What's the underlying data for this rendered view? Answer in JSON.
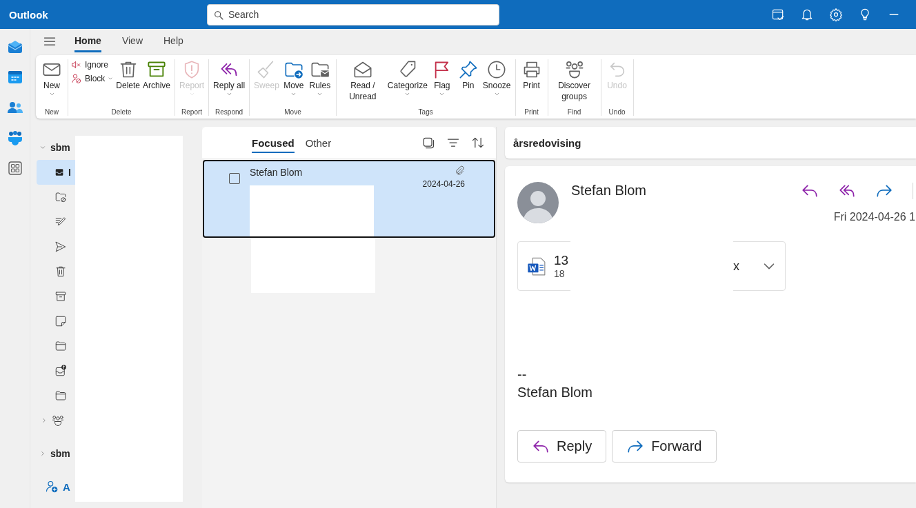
{
  "app": {
    "title": "Outlook"
  },
  "search": {
    "placeholder": "Search"
  },
  "tabs": [
    {
      "label": "Home",
      "selected": true
    },
    {
      "label": "View",
      "selected": false
    },
    {
      "label": "Help",
      "selected": false
    }
  ],
  "ribbon": {
    "groups": [
      {
        "label": "New",
        "buttons": [
          {
            "kind": "large",
            "label": "New",
            "caret": true,
            "disabled": false
          }
        ]
      },
      {
        "label": "Delete",
        "buttons": [
          {
            "kind": "small",
            "label": "Ignore",
            "caret": false,
            "disabled": false
          },
          {
            "kind": "small",
            "label": "Block",
            "caret": true,
            "disabled": false
          },
          {
            "kind": "large",
            "label": "Delete",
            "caret": false,
            "disabled": false
          },
          {
            "kind": "large",
            "label": "Archive",
            "caret": false,
            "disabled": false
          }
        ]
      },
      {
        "label": "Report",
        "buttons": [
          {
            "kind": "large",
            "label": "Report",
            "caret": true,
            "disabled": true
          }
        ]
      },
      {
        "label": "Respond",
        "buttons": [
          {
            "kind": "large",
            "label": "Reply all",
            "caret": true,
            "disabled": false
          }
        ]
      },
      {
        "label": "Move",
        "buttons": [
          {
            "kind": "large",
            "label": "Sweep",
            "caret": false,
            "disabled": true
          },
          {
            "kind": "large",
            "label": "Move",
            "caret": true,
            "disabled": false
          },
          {
            "kind": "large",
            "label": "Rules",
            "caret": true,
            "disabled": false
          }
        ]
      },
      {
        "label": "Tags",
        "buttons": [
          {
            "kind": "large",
            "label": "Read / Unread",
            "caret": false,
            "disabled": false
          },
          {
            "kind": "large",
            "label": "Categorize",
            "caret": true,
            "disabled": false
          },
          {
            "kind": "large",
            "label": "Flag",
            "caret": true,
            "disabled": false
          },
          {
            "kind": "large",
            "label": "Pin",
            "caret": false,
            "disabled": false
          },
          {
            "kind": "large",
            "label": "Snooze",
            "caret": true,
            "disabled": false
          }
        ]
      },
      {
        "label": "Print",
        "buttons": [
          {
            "kind": "large",
            "label": "Print",
            "caret": false,
            "disabled": false
          }
        ]
      },
      {
        "label": "Find",
        "buttons": [
          {
            "kind": "large",
            "label": "Discover groups",
            "caret": false,
            "disabled": false
          }
        ]
      },
      {
        "label": "Undo",
        "buttons": [
          {
            "kind": "large",
            "label": "Undo",
            "caret": false,
            "disabled": true
          }
        ]
      }
    ]
  },
  "folders": [
    {
      "kind": "account",
      "label": "sbm",
      "expanded": true,
      "children": [
        {
          "kind": "folder",
          "label": "I",
          "selected": true
        },
        {
          "kind": "folder",
          "selected": false
        },
        {
          "kind": "folder",
          "selected": false
        },
        {
          "kind": "folder",
          "selected": false
        },
        {
          "kind": "folder",
          "selected": false
        },
        {
          "kind": "folder",
          "selected": false
        },
        {
          "kind": "folder",
          "selected": false
        },
        {
          "kind": "folder",
          "selected": false
        },
        {
          "kind": "folder",
          "selected": false
        },
        {
          "kind": "folder",
          "selected": false
        },
        {
          "kind": "group",
          "expanded": false
        }
      ]
    },
    {
      "kind": "account",
      "label": "sbm",
      "expanded": false
    }
  ],
  "add_account": {
    "label": "A"
  },
  "list_tabs": [
    {
      "label": "Focused",
      "selected": true
    },
    {
      "label": "Other",
      "selected": false
    }
  ],
  "messages": [
    {
      "sender": "Stefan Blom",
      "date": "2024-04-26",
      "selected": true,
      "checked": false,
      "has_attachment": true
    }
  ],
  "reading": {
    "subject": "årsredovising",
    "sender": "Stefan Blom",
    "date": "Fri 2024-04-26 1",
    "attachment": {
      "name_start": "13",
      "name_end": "x",
      "size": "18"
    },
    "body": [
      "--",
      "Stefan Blom"
    ],
    "actions": [
      {
        "label": "Reply"
      },
      {
        "label": "Forward"
      }
    ]
  }
}
